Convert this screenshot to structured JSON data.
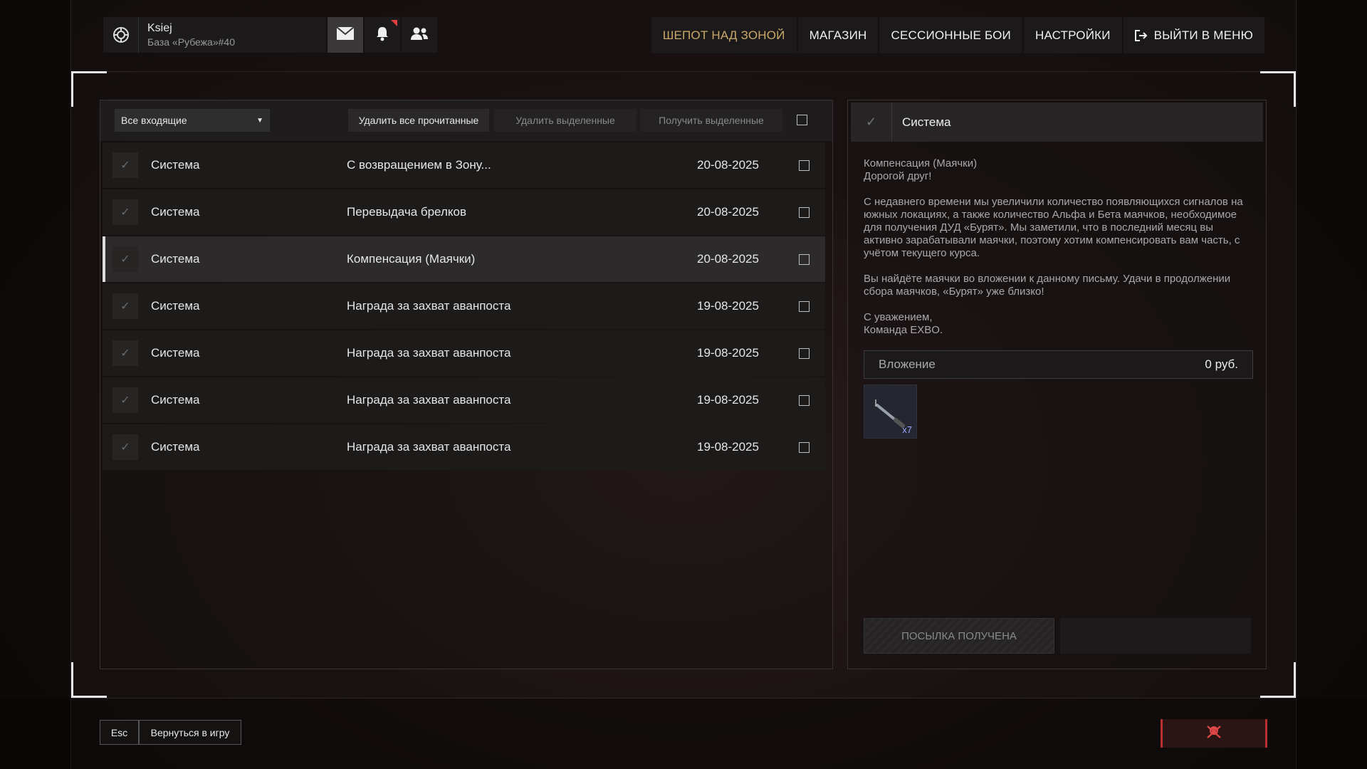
{
  "profile": {
    "name": "Ksiej",
    "base": "База «Рубежа»#40"
  },
  "top_icons": [
    "shield-icon",
    "mail-icon",
    "bell-icon",
    "friends-icon"
  ],
  "nav": [
    {
      "label": "ШЕПОТ НАД ЗОНОЙ"
    },
    {
      "label": "МАГАЗИН"
    },
    {
      "label": "СЕССИОННЫЕ БОИ"
    },
    {
      "label": "НАСТРОЙКИ"
    },
    {
      "label": "ВЫЙТИ В МЕНЮ"
    }
  ],
  "toolbar": {
    "filter": "Все входящие",
    "delete_read": "Удалить все прочитанные",
    "delete_selected": "Удалить выделенные",
    "receive_selected": "Получить выделенные"
  },
  "messages": [
    {
      "sender": "Система",
      "subject": "С возвращением в Зону...",
      "date": "20-08-2025"
    },
    {
      "sender": "Система",
      "subject": "Перевыдача брелков",
      "date": "20-08-2025"
    },
    {
      "sender": "Система",
      "subject": "Компенсация (Маячки)",
      "date": "20-08-2025",
      "selected": true
    },
    {
      "sender": "Система",
      "subject": "Награда за захват аванпоста",
      "date": "19-08-2025"
    },
    {
      "sender": "Система",
      "subject": "Награда за захват аванпоста",
      "date": "19-08-2025"
    },
    {
      "sender": "Система",
      "subject": "Награда за захват аванпоста",
      "date": "19-08-2025"
    },
    {
      "sender": "Система",
      "subject": "Награда за захват аванпоста",
      "date": "19-08-2025"
    }
  ],
  "detail": {
    "sender": "Система",
    "title": "Компенсация (Маячки)",
    "greeting": "Дорогой друг!",
    "paragraph1": "С недавнего времени мы увеличили количество появляющихся сигналов на южных локациях, а также количество Альфа и Бета маячков, необходимое для получения ДУД «Бурят». Мы заметили, что в последний месяц вы активно зарабатывали маячки, поэтому хотим компенсировать вам часть, с учётом текущего курса.",
    "paragraph2": "Вы найдёте маячки во вложении к данному письму. Удачи в продолжении сбора маячков, «Бурят» уже близко!",
    "signoff": "С уважением,",
    "team": "Команда EXBO.",
    "attachment_label": "Вложение",
    "attachment_amount": "0 руб.",
    "attachment_qty": "x7",
    "received_label": "ПОСЫЛКА ПОЛУЧЕНА"
  },
  "footer": {
    "esc": "Esc",
    "back": "Вернуться в игру"
  },
  "colors": {
    "accent": "#c9a86a",
    "selected_row": "#2c2a2a",
    "danger": "#b83030",
    "notification": "#e04040"
  }
}
